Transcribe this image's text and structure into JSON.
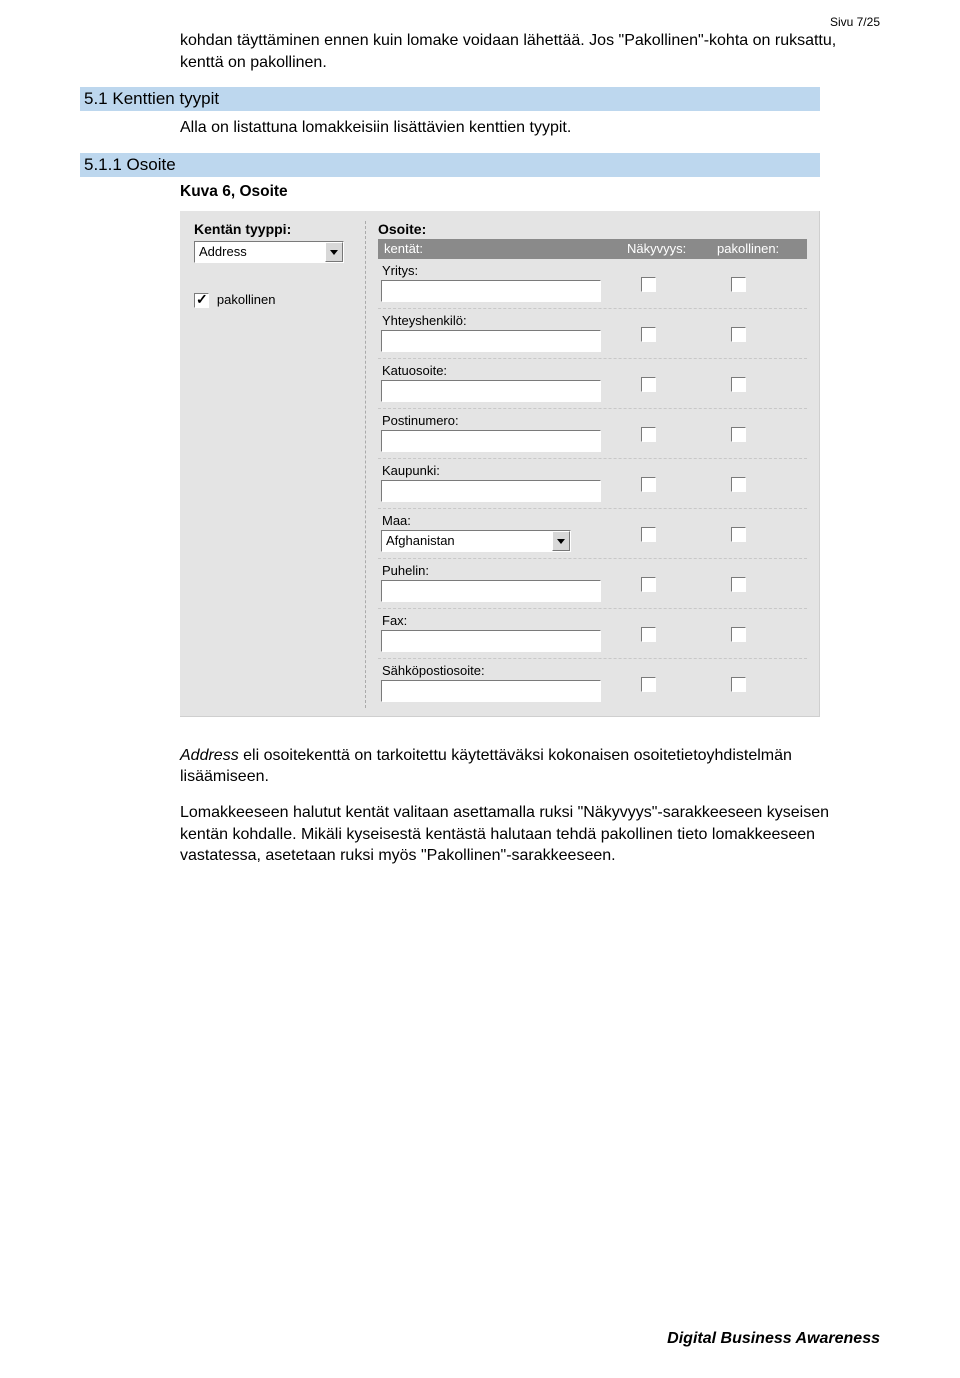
{
  "page_number": "Sivu 7/25",
  "intro_paragraph": "kohdan täyttäminen ennen kuin lomake voidaan lähettää. Jos \"Pakollinen\"-kohta on ruksattu, kenttä on pakollinen.",
  "section_5_1": {
    "heading": "5.1  Kenttien tyypit",
    "subtext": "Alla on listattuna lomakkeisiin lisättävien kenttien tyypit."
  },
  "section_5_1_1": {
    "heading": "5.1.1  Osoite",
    "figure_label": "Kuva 6, Osoite"
  },
  "form": {
    "left": {
      "type_label": "Kentän tyyppi:",
      "type_value": "Address",
      "mandatory_label": "pakollinen",
      "mandatory_checked": true
    },
    "right": {
      "title": "Osoite:",
      "columns": {
        "fields": "kentät:",
        "visibility": "Näkyvyys:",
        "mandatory": "pakollinen:"
      },
      "fields": [
        {
          "label": "Yritys:",
          "type": "text"
        },
        {
          "label": "Yhteyshenkilö:",
          "type": "text"
        },
        {
          "label": "Katuosoite:",
          "type": "text"
        },
        {
          "label": "Postinumero:",
          "type": "text"
        },
        {
          "label": "Kaupunki:",
          "type": "text"
        },
        {
          "label": "Maa:",
          "type": "select",
          "value": "Afghanistan"
        },
        {
          "label": "Puhelin:",
          "type": "text"
        },
        {
          "label": "Fax:",
          "type": "text"
        },
        {
          "label": "Sähköpostiosoite:",
          "type": "text"
        }
      ]
    }
  },
  "after_form": {
    "p1_italic": "Address",
    "p1_rest": " eli osoitekenttä on tarkoitettu käytettäväksi kokonaisen osoitetietoyhdistelmän lisäämiseen.",
    "p2": "Lomakkeeseen halutut kentät valitaan asettamalla ruksi \"Näkyvyys\"-sarakkeeseen kyseisen kentän kohdalle. Mikäli kyseisestä kentästä halutaan tehdä pakollinen tieto lomakkeeseen vastatessa, asetetaan ruksi myös \"Pakollinen\"-sarakkeeseen."
  },
  "footer": "Digital Business Awareness"
}
